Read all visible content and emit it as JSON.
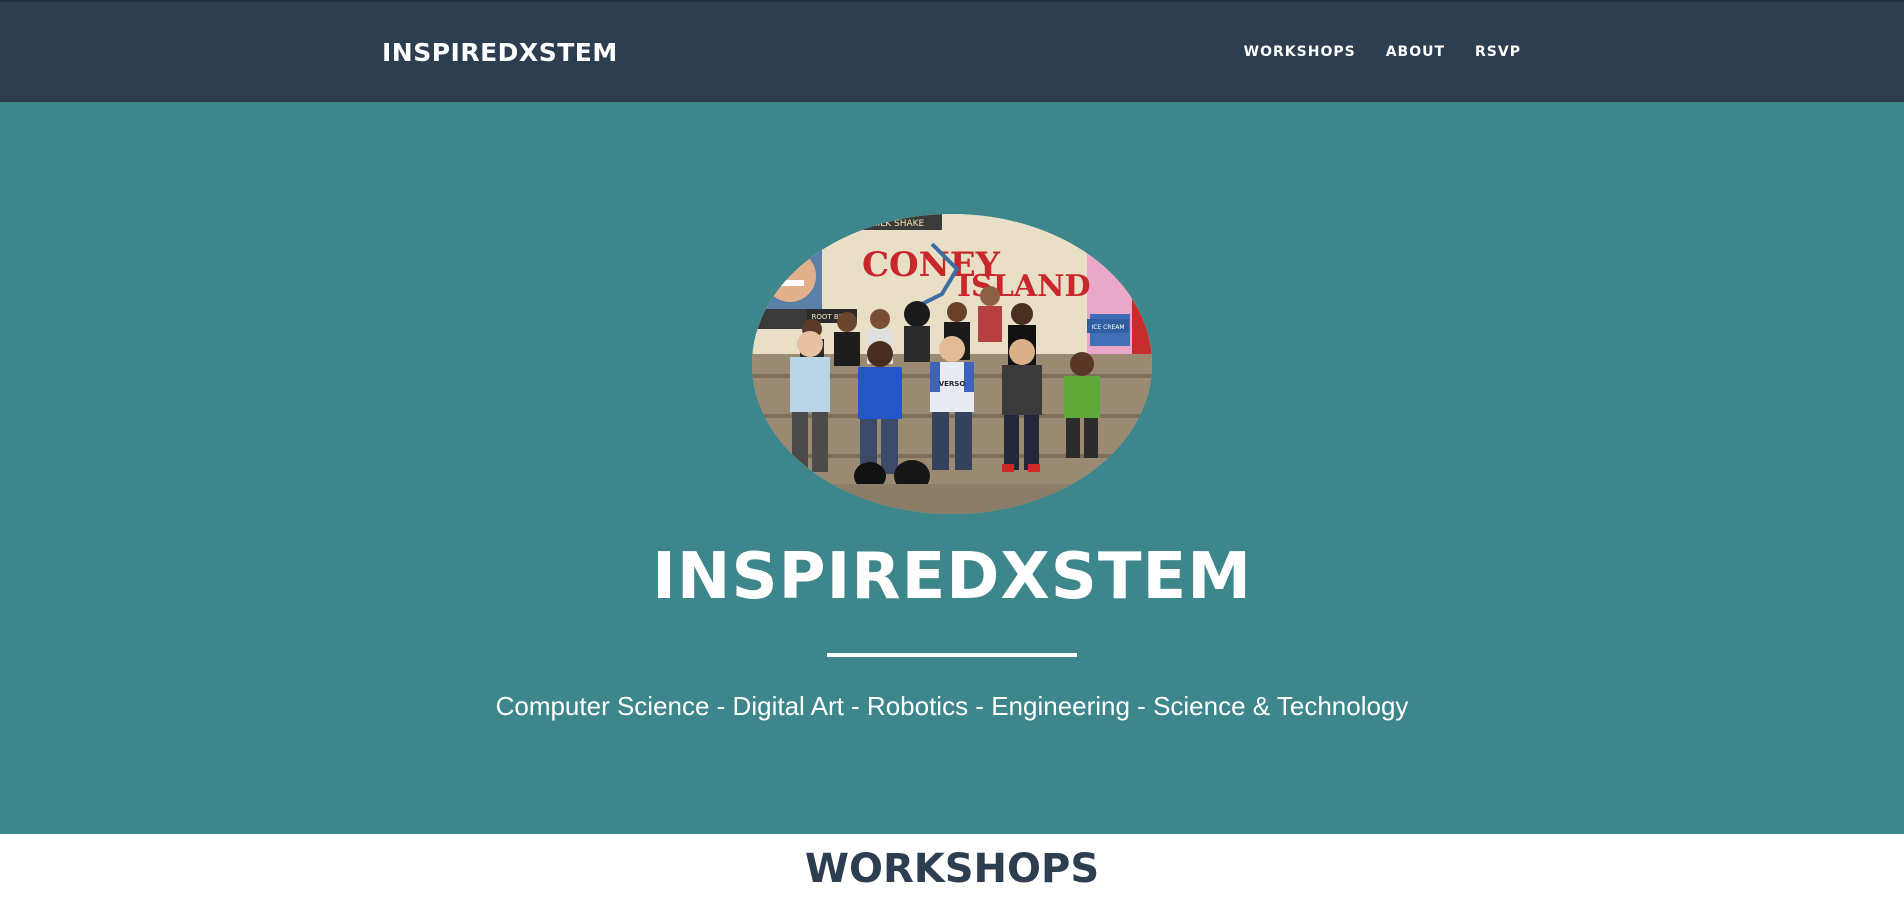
{
  "navbar": {
    "brand": "INSPIREDXSTEM",
    "links": [
      {
        "label": "WORKSHOPS"
      },
      {
        "label": "ABOUT"
      },
      {
        "label": "RSVP"
      }
    ]
  },
  "hero": {
    "photo_signs": {
      "top_banner": "MILK SHAKE",
      "coney": "CONEY",
      "island": "ISLAND",
      "root_beer": "ROOT BEER",
      "ice_cream": "ICE CREAM",
      "shirt": "VERSO"
    },
    "title": "INSPIREDXSTEM",
    "subtitle": "Computer Science - Digital Art - Robotics - Engineering - Science & Technology"
  },
  "workshops": {
    "heading": "WORKSHOPS"
  },
  "colors": {
    "navbar_bg": "#2c3e50",
    "hero_bg": "#3d868b",
    "text_light": "#ffffff",
    "heading_dark": "#2c3e50"
  }
}
